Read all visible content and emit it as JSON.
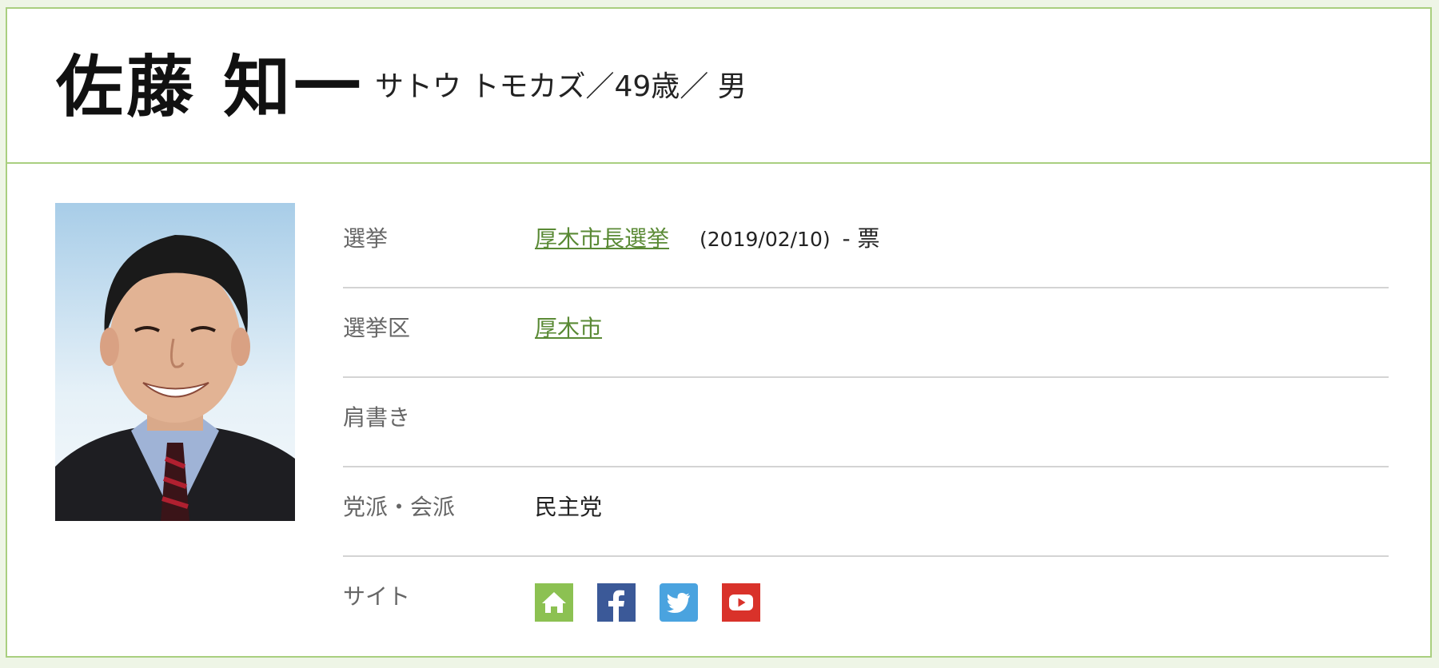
{
  "candidate": {
    "name": "佐藤 知一",
    "reading_line": "サトウ トモカズ／49歳／ 男"
  },
  "details": {
    "election": {
      "label": "選挙",
      "link_text": "厚木市長選挙",
      "date": "(2019/02/10)",
      "votes": "- 票"
    },
    "district": {
      "label": "選挙区",
      "link_text": "厚木市"
    },
    "title": {
      "label": "肩書き",
      "value": ""
    },
    "party": {
      "label": "党派・会派",
      "value": "民主党"
    },
    "sites": {
      "label": "サイト",
      "icons": [
        {
          "name": "home-icon",
          "color": "#8cc152"
        },
        {
          "name": "facebook-icon",
          "color": "#3b5998"
        },
        {
          "name": "twitter-icon",
          "color": "#4aa3df"
        },
        {
          "name": "youtube-icon",
          "color": "#d9322a"
        }
      ]
    }
  },
  "colors": {
    "accent_border": "#a9cf7f",
    "link": "#5a8a35",
    "background": "#eef5e6"
  }
}
